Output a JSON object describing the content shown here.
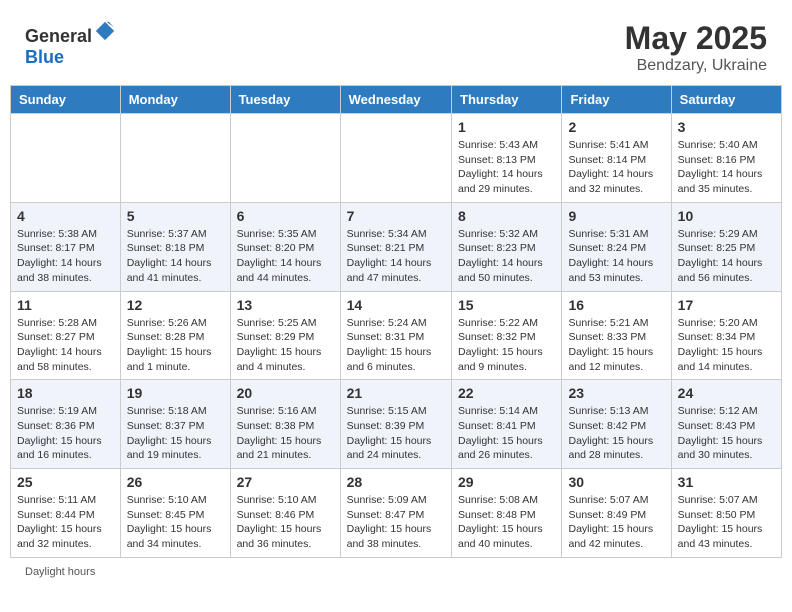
{
  "header": {
    "logo_general": "General",
    "logo_blue": "Blue",
    "month_year": "May 2025",
    "location": "Bendzary, Ukraine"
  },
  "days_of_week": [
    "Sunday",
    "Monday",
    "Tuesday",
    "Wednesday",
    "Thursday",
    "Friday",
    "Saturday"
  ],
  "footer": {
    "daylight_label": "Daylight hours"
  },
  "weeks": [
    {
      "days": [
        {
          "date": "",
          "info": ""
        },
        {
          "date": "",
          "info": ""
        },
        {
          "date": "",
          "info": ""
        },
        {
          "date": "",
          "info": ""
        },
        {
          "date": "1",
          "info": "Sunrise: 5:43 AM\nSunset: 8:13 PM\nDaylight: 14 hours\nand 29 minutes."
        },
        {
          "date": "2",
          "info": "Sunrise: 5:41 AM\nSunset: 8:14 PM\nDaylight: 14 hours\nand 32 minutes."
        },
        {
          "date": "3",
          "info": "Sunrise: 5:40 AM\nSunset: 8:16 PM\nDaylight: 14 hours\nand 35 minutes."
        }
      ]
    },
    {
      "days": [
        {
          "date": "4",
          "info": "Sunrise: 5:38 AM\nSunset: 8:17 PM\nDaylight: 14 hours\nand 38 minutes."
        },
        {
          "date": "5",
          "info": "Sunrise: 5:37 AM\nSunset: 8:18 PM\nDaylight: 14 hours\nand 41 minutes."
        },
        {
          "date": "6",
          "info": "Sunrise: 5:35 AM\nSunset: 8:20 PM\nDaylight: 14 hours\nand 44 minutes."
        },
        {
          "date": "7",
          "info": "Sunrise: 5:34 AM\nSunset: 8:21 PM\nDaylight: 14 hours\nand 47 minutes."
        },
        {
          "date": "8",
          "info": "Sunrise: 5:32 AM\nSunset: 8:23 PM\nDaylight: 14 hours\nand 50 minutes."
        },
        {
          "date": "9",
          "info": "Sunrise: 5:31 AM\nSunset: 8:24 PM\nDaylight: 14 hours\nand 53 minutes."
        },
        {
          "date": "10",
          "info": "Sunrise: 5:29 AM\nSunset: 8:25 PM\nDaylight: 14 hours\nand 56 minutes."
        }
      ]
    },
    {
      "days": [
        {
          "date": "11",
          "info": "Sunrise: 5:28 AM\nSunset: 8:27 PM\nDaylight: 14 hours\nand 58 minutes."
        },
        {
          "date": "12",
          "info": "Sunrise: 5:26 AM\nSunset: 8:28 PM\nDaylight: 15 hours\nand 1 minute."
        },
        {
          "date": "13",
          "info": "Sunrise: 5:25 AM\nSunset: 8:29 PM\nDaylight: 15 hours\nand 4 minutes."
        },
        {
          "date": "14",
          "info": "Sunrise: 5:24 AM\nSunset: 8:31 PM\nDaylight: 15 hours\nand 6 minutes."
        },
        {
          "date": "15",
          "info": "Sunrise: 5:22 AM\nSunset: 8:32 PM\nDaylight: 15 hours\nand 9 minutes."
        },
        {
          "date": "16",
          "info": "Sunrise: 5:21 AM\nSunset: 8:33 PM\nDaylight: 15 hours\nand 12 minutes."
        },
        {
          "date": "17",
          "info": "Sunrise: 5:20 AM\nSunset: 8:34 PM\nDaylight: 15 hours\nand 14 minutes."
        }
      ]
    },
    {
      "days": [
        {
          "date": "18",
          "info": "Sunrise: 5:19 AM\nSunset: 8:36 PM\nDaylight: 15 hours\nand 16 minutes."
        },
        {
          "date": "19",
          "info": "Sunrise: 5:18 AM\nSunset: 8:37 PM\nDaylight: 15 hours\nand 19 minutes."
        },
        {
          "date": "20",
          "info": "Sunrise: 5:16 AM\nSunset: 8:38 PM\nDaylight: 15 hours\nand 21 minutes."
        },
        {
          "date": "21",
          "info": "Sunrise: 5:15 AM\nSunset: 8:39 PM\nDaylight: 15 hours\nand 24 minutes."
        },
        {
          "date": "22",
          "info": "Sunrise: 5:14 AM\nSunset: 8:41 PM\nDaylight: 15 hours\nand 26 minutes."
        },
        {
          "date": "23",
          "info": "Sunrise: 5:13 AM\nSunset: 8:42 PM\nDaylight: 15 hours\nand 28 minutes."
        },
        {
          "date": "24",
          "info": "Sunrise: 5:12 AM\nSunset: 8:43 PM\nDaylight: 15 hours\nand 30 minutes."
        }
      ]
    },
    {
      "days": [
        {
          "date": "25",
          "info": "Sunrise: 5:11 AM\nSunset: 8:44 PM\nDaylight: 15 hours\nand 32 minutes."
        },
        {
          "date": "26",
          "info": "Sunrise: 5:10 AM\nSunset: 8:45 PM\nDaylight: 15 hours\nand 34 minutes."
        },
        {
          "date": "27",
          "info": "Sunrise: 5:10 AM\nSunset: 8:46 PM\nDaylight: 15 hours\nand 36 minutes."
        },
        {
          "date": "28",
          "info": "Sunrise: 5:09 AM\nSunset: 8:47 PM\nDaylight: 15 hours\nand 38 minutes."
        },
        {
          "date": "29",
          "info": "Sunrise: 5:08 AM\nSunset: 8:48 PM\nDaylight: 15 hours\nand 40 minutes."
        },
        {
          "date": "30",
          "info": "Sunrise: 5:07 AM\nSunset: 8:49 PM\nDaylight: 15 hours\nand 42 minutes."
        },
        {
          "date": "31",
          "info": "Sunrise: 5:07 AM\nSunset: 8:50 PM\nDaylight: 15 hours\nand 43 minutes."
        }
      ]
    }
  ]
}
